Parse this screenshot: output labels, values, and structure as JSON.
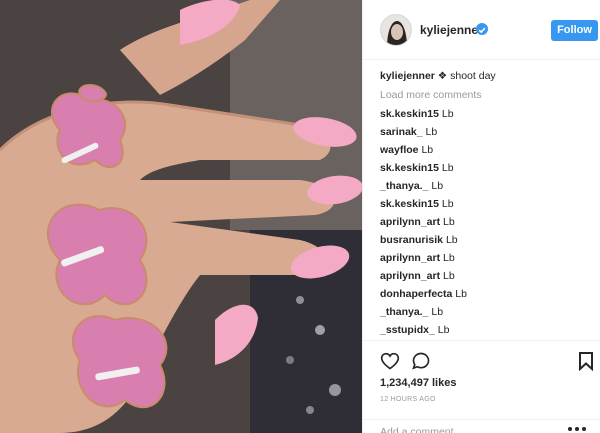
{
  "post": {
    "username": "kyliejenner",
    "follow_label": "Follow",
    "caption_user": "kyliejenner",
    "caption_text": "❖ shoot day",
    "load_more": "Load more comments",
    "comments": [
      {
        "user": "sk.keskin15",
        "text": "Lb"
      },
      {
        "user": "sarinak_",
        "text": "Lb"
      },
      {
        "user": "wayfloe",
        "text": "Lb"
      },
      {
        "user": "sk.keskin15",
        "text": "Lb"
      },
      {
        "user": "_thanya._",
        "text": "Lb"
      },
      {
        "user": "sk.keskin15",
        "text": "Lb"
      },
      {
        "user": "aprilynn_art",
        "text": "Lb"
      },
      {
        "user": "busranurisik",
        "text": "Lb"
      },
      {
        "user": "aprilynn_art",
        "text": "Lb"
      },
      {
        "user": "aprilynn_art",
        "text": "Lb"
      },
      {
        "user": "donhaperfecta",
        "text": "Lb"
      },
      {
        "user": "_thanya._",
        "text": "Lb"
      },
      {
        "user": "_sstupidx_",
        "text": "Lb"
      }
    ],
    "likes": "1,234,497 likes",
    "time": "12 HOURS AGO",
    "add_comment_placeholder": "Add a comment..."
  },
  "icons": {
    "verified": "verified-badge-icon",
    "like": "heart-icon",
    "comment": "comment-bubble-icon",
    "save": "bookmark-icon",
    "more": "more-options-icon"
  },
  "colors": {
    "accent": "#3897f0",
    "nail_pink": "#f4a9c4",
    "gem_pink": "#d97fb0",
    "muted_text": "#999999"
  }
}
